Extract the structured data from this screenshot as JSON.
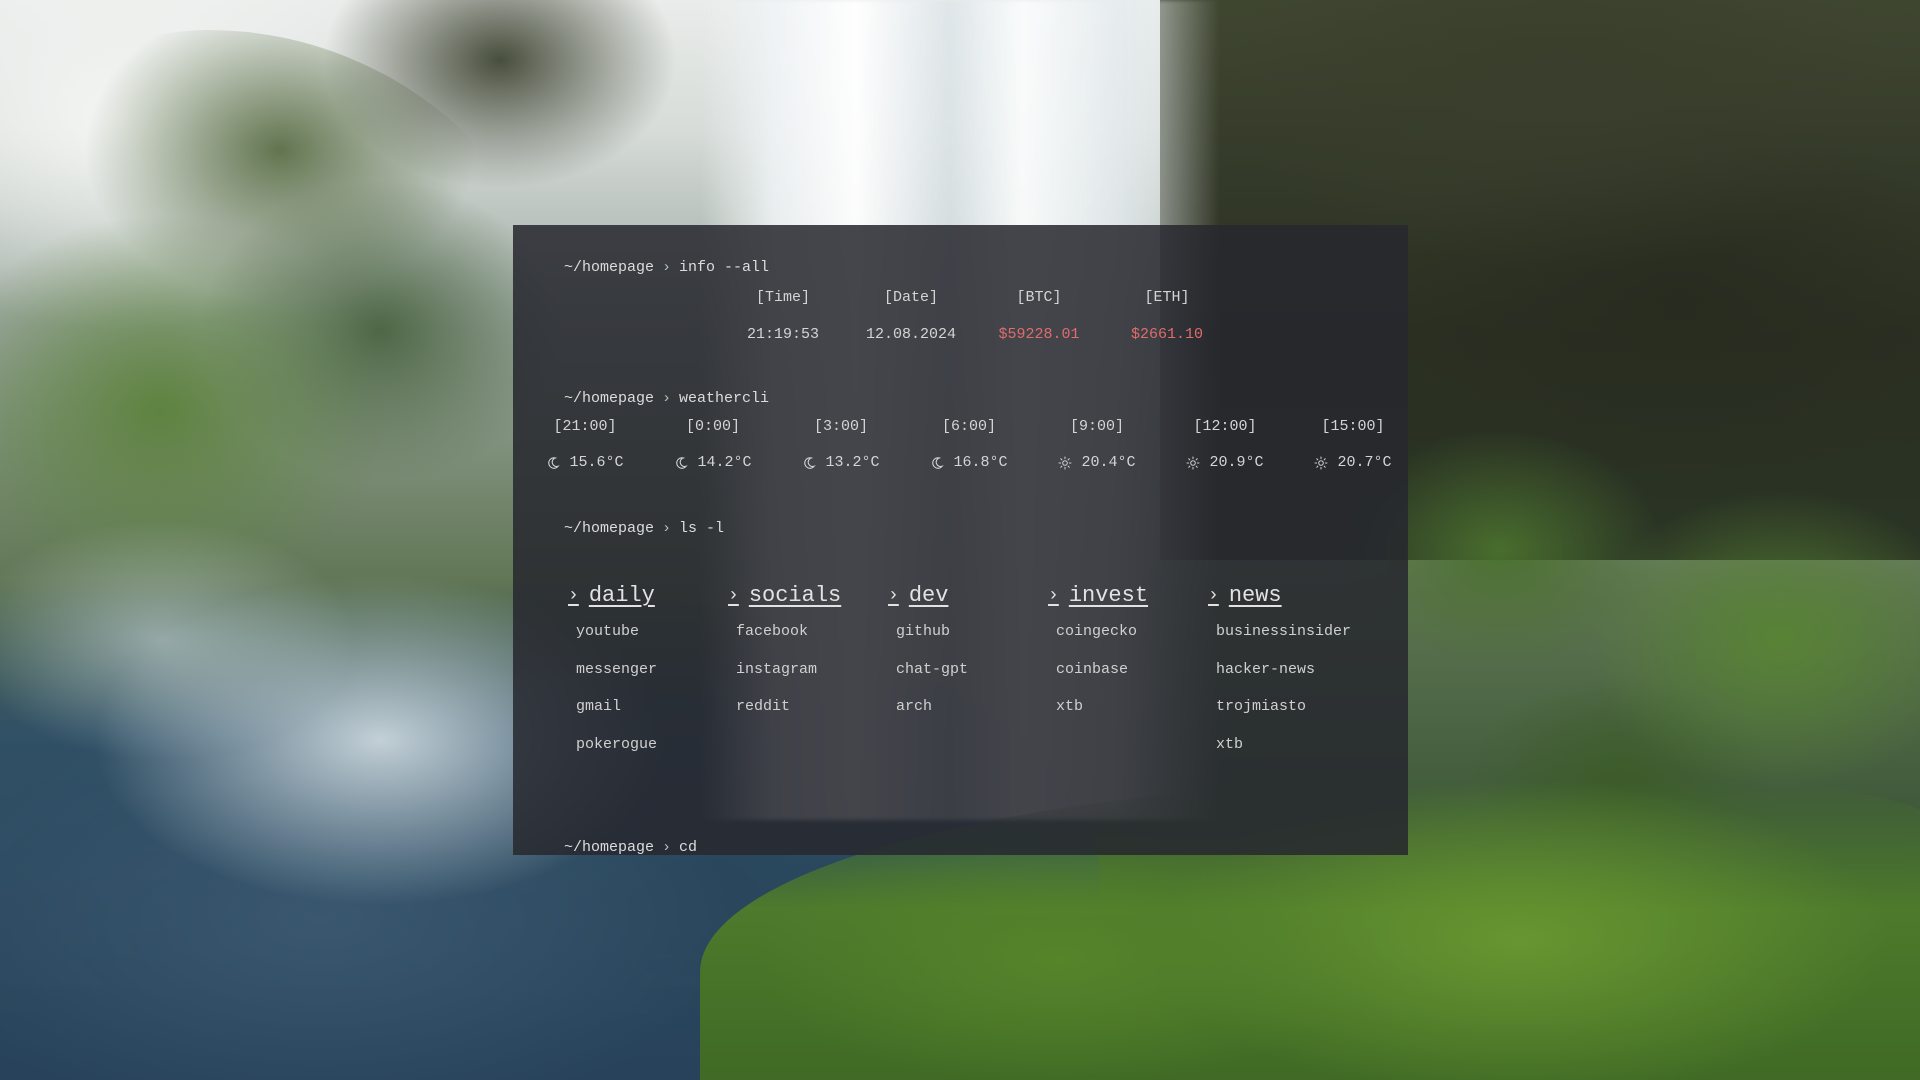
{
  "prompts": {
    "info": {
      "path": "~/homepage",
      "sep": "›",
      "cmd": "info --all"
    },
    "weather": {
      "path": "~/homepage",
      "sep": "›",
      "cmd": "weathercli"
    },
    "ls": {
      "path": "~/homepage",
      "sep": "›",
      "cmd": "ls -l"
    },
    "cd": {
      "path": "~/homepage",
      "sep": "›",
      "cmd": "cd"
    }
  },
  "info": {
    "headers": [
      "[Time]",
      "[Date]",
      "[BTC]",
      "[ETH]"
    ],
    "time": "21:19:53",
    "date": "12.08.2024",
    "btc": "$59228.01",
    "eth": "$2661.10"
  },
  "weather": {
    "hours": [
      {
        "label": "[21:00]",
        "icon": "moon-icon",
        "temp": "15.6°C"
      },
      {
        "label": "[0:00]",
        "icon": "moon-icon",
        "temp": "14.2°C"
      },
      {
        "label": "[3:00]",
        "icon": "moon-icon",
        "temp": "13.2°C"
      },
      {
        "label": "[6:00]",
        "icon": "moon-icon",
        "temp": "16.8°C"
      },
      {
        "label": "[9:00]",
        "icon": "sun-icon",
        "temp": "20.4°C"
      },
      {
        "label": "[12:00]",
        "icon": "sun-icon",
        "temp": "20.9°C"
      },
      {
        "label": "[15:00]",
        "icon": "sun-icon",
        "temp": "20.7°C"
      }
    ]
  },
  "bookmarks": [
    {
      "title": "daily",
      "links": [
        "youtube",
        "messenger",
        "gmail",
        "pokerogue"
      ]
    },
    {
      "title": "socials",
      "links": [
        "facebook",
        "instagram",
        "reddit"
      ]
    },
    {
      "title": "dev",
      "links": [
        "github",
        "chat-gpt",
        "arch"
      ]
    },
    {
      "title": "invest",
      "links": [
        "coingecko",
        "coinbase",
        "xtb"
      ]
    },
    {
      "title": "news",
      "links": [
        "businessinsider",
        "hacker-news",
        "trojmiasto",
        "xtb"
      ]
    }
  ],
  "colors": {
    "price": "#e06c6c",
    "panel": "rgba(38,40,46,0.86)",
    "text": "#d6d6d6"
  }
}
